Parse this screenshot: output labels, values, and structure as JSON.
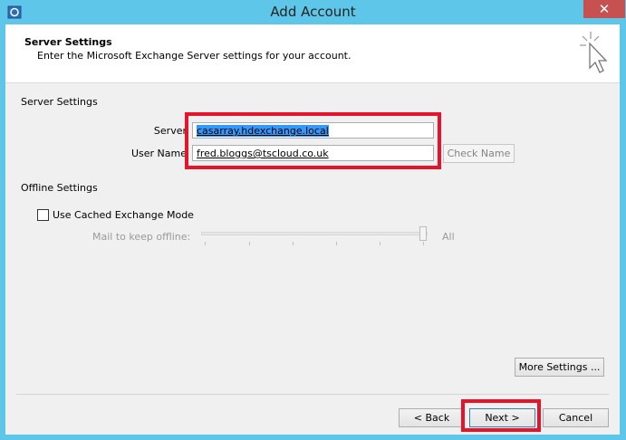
{
  "window": {
    "title": "Add Account",
    "close_label": "✕"
  },
  "header": {
    "title": "Server Settings",
    "subtitle": "Enter the Microsoft Exchange Server settings for your account."
  },
  "server_settings": {
    "section_label": "Server Settings",
    "server_label": "Server",
    "server_value": "casarray.hdexchange.local",
    "username_label": "User Name",
    "username_value": "fred.bloggs@tscloud.co.uk",
    "check_name_label": "Check Name"
  },
  "offline_settings": {
    "section_label": "Offline Settings",
    "cached_mode_label": "Use Cached Exchange Mode",
    "cached_mode_checked": false,
    "mail_keep_label": "Mail to keep offline:",
    "mail_keep_value": "All",
    "slider_level": 1.0
  },
  "buttons": {
    "more_settings": "More Settings ...",
    "back": "< Back",
    "next": "Next >",
    "cancel": "Cancel"
  },
  "colors": {
    "titlebar": "#5ec7e9",
    "close": "#c75050",
    "highlight_box": "#e5142b",
    "selection": "#3399ff"
  }
}
